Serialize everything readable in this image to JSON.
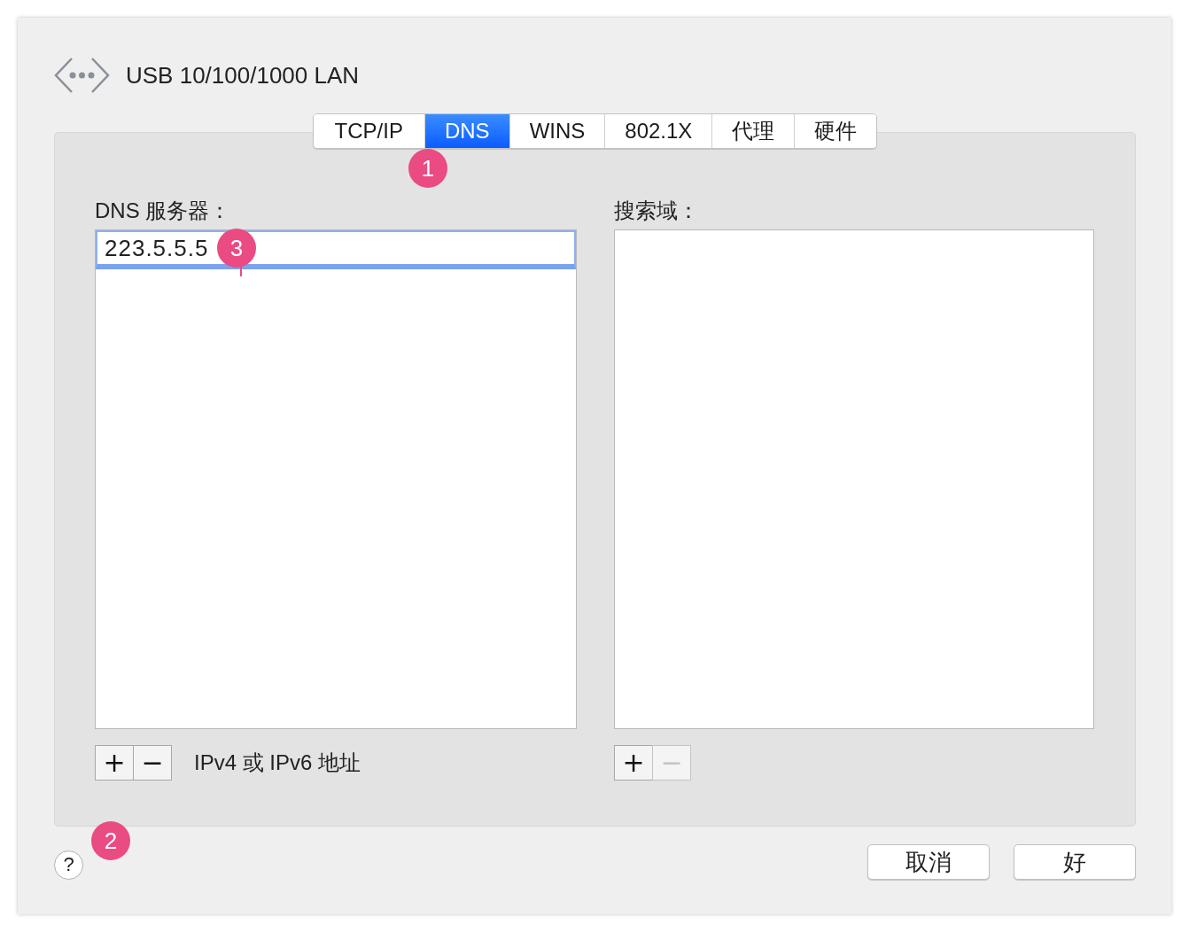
{
  "window": {
    "title": "USB 10/100/1000 LAN"
  },
  "tabs": [
    {
      "label": "TCP/IP",
      "selected": false
    },
    {
      "label": "DNS",
      "selected": true
    },
    {
      "label": "WINS",
      "selected": false
    },
    {
      "label": "802.1X",
      "selected": false
    },
    {
      "label": "代理",
      "selected": false
    },
    {
      "label": "硬件",
      "selected": false
    }
  ],
  "dns_servers": {
    "label": "DNS 服务器：",
    "items": [
      {
        "value": "223.5.5.5",
        "selected": true
      }
    ],
    "add_button": {
      "label": "+",
      "disabled": false
    },
    "remove_button": {
      "label": "−",
      "disabled": false
    },
    "hint": "IPv4 或 IPv6 地址"
  },
  "search_domains": {
    "label": "搜索域：",
    "add_button": {
      "label": "+",
      "disabled": false
    },
    "remove_button": {
      "label": "−",
      "disabled": true
    }
  },
  "annotations": [
    {
      "label": "1"
    },
    {
      "label": "2"
    },
    {
      "label": "3"
    }
  ],
  "help_button": {
    "label": "?"
  },
  "buttons": [
    {
      "label": "取消"
    },
    {
      "label": "好"
    }
  ]
}
